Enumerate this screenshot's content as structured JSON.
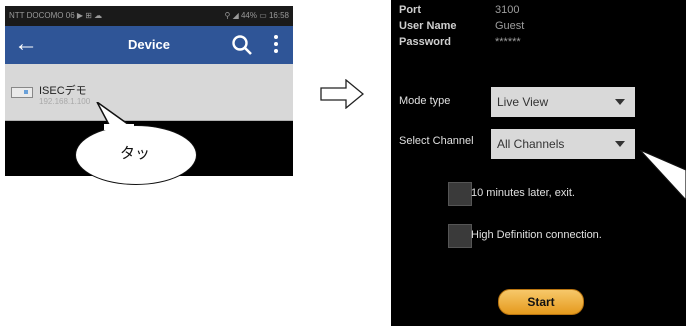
{
  "left_screen": {
    "status": {
      "carrier": "NTT DOCOMO 06 ▶ ⊞ ☁",
      "system": "⚲ ◢ 44% ▭ 16:58"
    },
    "appbar": {
      "back": "←",
      "title": "Device"
    },
    "device": {
      "name": "ISECデモ",
      "subtitle": "192.168.1.100"
    },
    "callout": "タッ"
  },
  "right_screen": {
    "info": [
      {
        "label": "Port",
        "value": "3100"
      },
      {
        "label": "User Name",
        "value": "Guest"
      },
      {
        "label": "Password",
        "value": "******"
      }
    ],
    "mode": {
      "label": "Mode type",
      "value": "Live View"
    },
    "channel": {
      "label": "Select Channel",
      "value": "All Channels"
    },
    "options": {
      "exit_label": "10 minutes later, exit.",
      "hd_label": "High Definition connection."
    },
    "start_label": "Start"
  },
  "colors": {
    "appbar": "#2f5597",
    "start_button": "#f0a830",
    "background": "#000000"
  }
}
